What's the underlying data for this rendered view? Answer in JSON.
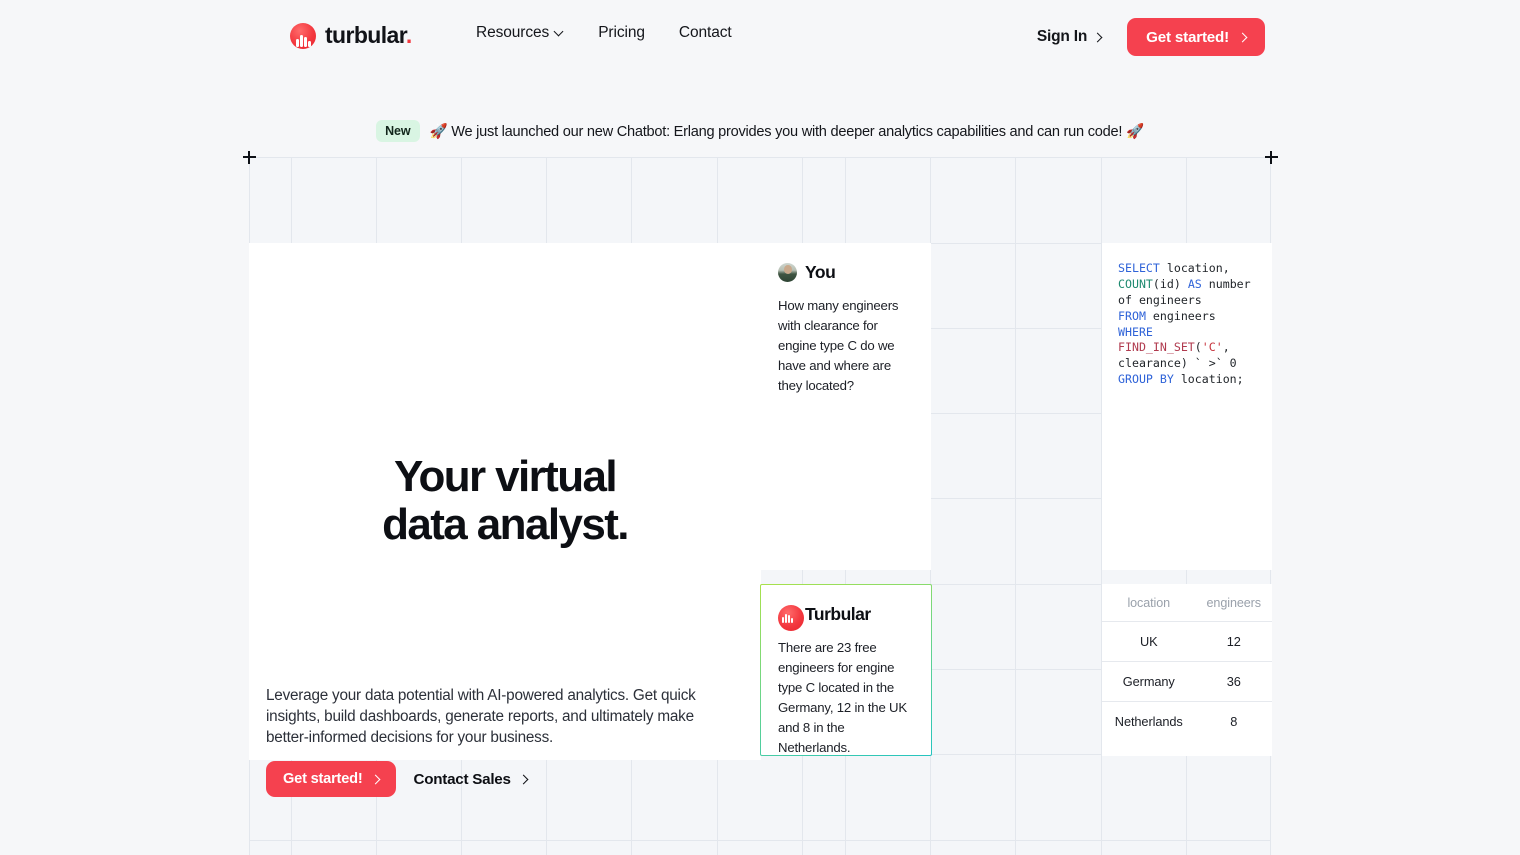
{
  "header": {
    "logo_text": "turbular",
    "logo_dot": ".",
    "logo_icon": "turbular-dome-logo",
    "nav": [
      {
        "label": "Resources",
        "has_caret": true
      },
      {
        "label": "Pricing",
        "has_caret": false
      },
      {
        "label": "Contact",
        "has_caret": false
      }
    ],
    "signin_label": "Sign In",
    "cta_label": "Get started!"
  },
  "banner": {
    "badge": "New",
    "text": "🚀 We just launched our new Chatbot: Erlang provides you with deeper analytics capabilities and can run code! 🚀"
  },
  "hero": {
    "title_line1": "Your virtual",
    "title_line2": "data analyst.",
    "subtitle": "Leverage your data potential with AI-powered analytics. Get quick insights, build dashboards, generate reports, and ultimately make better-informed decisions for your business.",
    "cta_primary": "Get started!",
    "cta_secondary": "Contact Sales"
  },
  "chat": {
    "user": {
      "name": "You",
      "avatar": "user-photo-avatar",
      "message": "How many engineers with clearance for engine type C do we have and where are they located?"
    },
    "assistant": {
      "name": "Turbular",
      "avatar": "turbular-dome-logo",
      "message": "There are 23 free engineers for engine type C located in the Germany, 12 in the UK and 8 in the Netherlands."
    }
  },
  "sql": {
    "tokens": [
      {
        "t": "SELECT",
        "c": "kw"
      },
      {
        "t": " location,\n",
        "c": "op"
      },
      {
        "t": "COUNT",
        "c": "fn"
      },
      {
        "t": "(id) ",
        "c": "op"
      },
      {
        "t": "AS",
        "c": "kw"
      },
      {
        "t": " number of engineers\n",
        "c": "op"
      },
      {
        "t": "FROM",
        "c": "kw"
      },
      {
        "t": " engineers\n",
        "c": "op"
      },
      {
        "t": "WHERE",
        "c": "kw"
      },
      {
        "t": "\n",
        "c": "op"
      },
      {
        "t": "FIND_IN_SET",
        "c": "fn2"
      },
      {
        "t": "(",
        "c": "op"
      },
      {
        "t": "'C'",
        "c": "str"
      },
      {
        "t": ", clearance) ` >` 0\n",
        "c": "op"
      },
      {
        "t": "GROUP BY",
        "c": "kw"
      },
      {
        "t": " location;",
        "c": "op"
      }
    ],
    "plain": "SELECT location, COUNT(id) AS number of engineers FROM engineers WHERE FIND_IN_SET('C', clearance) ` >` 0 GROUP BY location;"
  },
  "result_table": {
    "columns": [
      "location",
      "engineers"
    ],
    "rows": [
      [
        "UK",
        "12"
      ],
      [
        "Germany",
        "36"
      ],
      [
        "Netherlands",
        "8"
      ]
    ]
  },
  "colors": {
    "accent_red": "#f5414f",
    "badge_green_bg": "#d9f5e3",
    "card_border_gradient_start": "#a9e14a",
    "card_border_gradient_end": "#25c4c0",
    "grid_line": "#e3e7ed",
    "page_bg": "#f6f7f9"
  }
}
